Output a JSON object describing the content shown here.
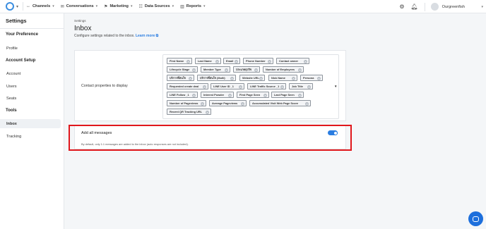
{
  "topnav": {
    "items": [
      {
        "icon": "channels-icon",
        "glyph": "↔",
        "label": "Channels"
      },
      {
        "icon": "conversations-icon",
        "glyph": "✉",
        "label": "Conversations"
      },
      {
        "icon": "marketing-icon",
        "glyph": "⚑",
        "label": "Marketing"
      },
      {
        "icon": "data-sources-icon",
        "glyph": "☷",
        "label": "Data Sources"
      },
      {
        "icon": "reports-icon",
        "glyph": "▥",
        "label": "Reports"
      }
    ],
    "username": "Ourgreenfish"
  },
  "sidebar": {
    "title": "Settings",
    "sections": [
      {
        "label": "Your Preference"
      },
      {
        "label": "Account Setup"
      },
      {
        "label": "Tools"
      }
    ],
    "items": [
      {
        "label": "Profile"
      },
      {
        "label": "Account"
      },
      {
        "label": "Users"
      },
      {
        "label": "Seats"
      },
      {
        "label": "Inbox"
      },
      {
        "label": "Tracking"
      }
    ]
  },
  "main": {
    "breadcrumb": "Settings",
    "title": "Inbox",
    "description": "Configure settings related to the inbox.",
    "learn_more": "Learn more ⧉"
  },
  "contact_properties": {
    "label": "Contact properties to display",
    "chips": [
      "First Name",
      "Last Name",
      "Email",
      "Phone Number",
      "Contact owner",
      "Lifecycle Stage",
      "Member Type",
      "ประเภทธุรกิจ",
      "Number of Employees",
      "บริการที่สนใจ",
      "บริการที่สนใจ (Multi)",
      "Website URL",
      "Nick Name",
      "Persona",
      "Requested create deal",
      "LINE User ID _1",
      "LINE Traffic Source _1",
      "Job Title",
      "LINE Follow _1",
      "Interest Powder",
      "First Page Seen",
      "Last Page Seen",
      "Number of Pageviews",
      "Average Pageviews",
      "Accumulated Visit Web Page Score",
      "Recent QR Tracking URL"
    ]
  },
  "add_all_messages": {
    "title": "Add all messages",
    "description": "By default, only 1:1 messages are added to the inbox (auto responses are not included).",
    "enabled": true
  },
  "colors": {
    "accent": "#2a7de1",
    "highlight": "#e0171c",
    "fab": "#1d6fdc"
  }
}
